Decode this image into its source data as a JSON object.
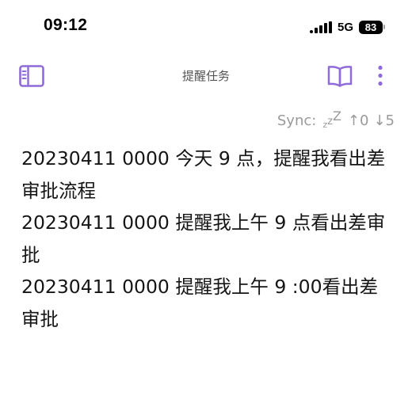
{
  "status_bar": {
    "time": "09:12",
    "network": "5G",
    "battery": "83"
  },
  "nav": {
    "title": "提醒任务",
    "icons": {
      "left": "sidebar-toggle-icon",
      "reading": "open-book-icon",
      "more": "vertical-ellipsis-icon"
    }
  },
  "sync": {
    "label": "Sync:",
    "state_icon": "sleep-zzz-icon",
    "upload": "↑0",
    "download": "↓5"
  },
  "note": {
    "lines": [
      "20230411 0000 今天 9 点，提醒我看出差审批流程",
      "20230411 0000 提醒我上午 9 点看出差审批",
      "20230411 0000 提醒我上午 9 :00看出差审批"
    ]
  },
  "colors": {
    "accent": "#8e6bd8",
    "muted_text": "#9a9a9a",
    "title_text": "#555555",
    "body_text": "#151515"
  }
}
